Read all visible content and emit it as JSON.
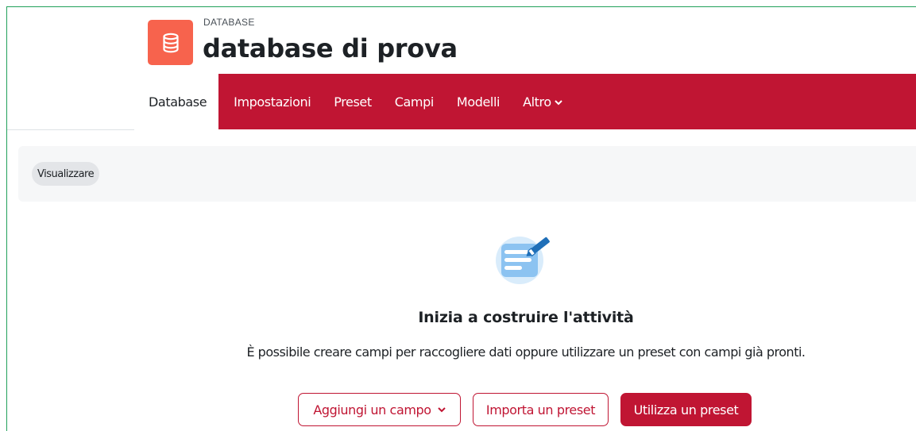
{
  "header": {
    "kicker": "DATABASE",
    "title": "database di prova",
    "icon": "database-icon",
    "icon_bg": "#f7634d"
  },
  "nav": {
    "tabs": [
      {
        "label": "Database",
        "active": true
      },
      {
        "label": "Impostazioni"
      },
      {
        "label": "Preset"
      },
      {
        "label": "Campi"
      },
      {
        "label": "Modelli"
      },
      {
        "label": "Altro",
        "has_dropdown": true
      }
    ],
    "bar_color": "#c01533"
  },
  "tertiary": {
    "view_label": "Visualizzare"
  },
  "empty_state": {
    "icon": "note-pencil-icon",
    "title": "Inizia a costruire l'attività",
    "description": "È possibile creare campi per raccogliere dati oppure utilizzare un preset con campi già pronti."
  },
  "actions": {
    "add_field": "Aggiungi un campo",
    "import_preset": "Importa un preset",
    "use_preset": "Utilizza un preset"
  }
}
